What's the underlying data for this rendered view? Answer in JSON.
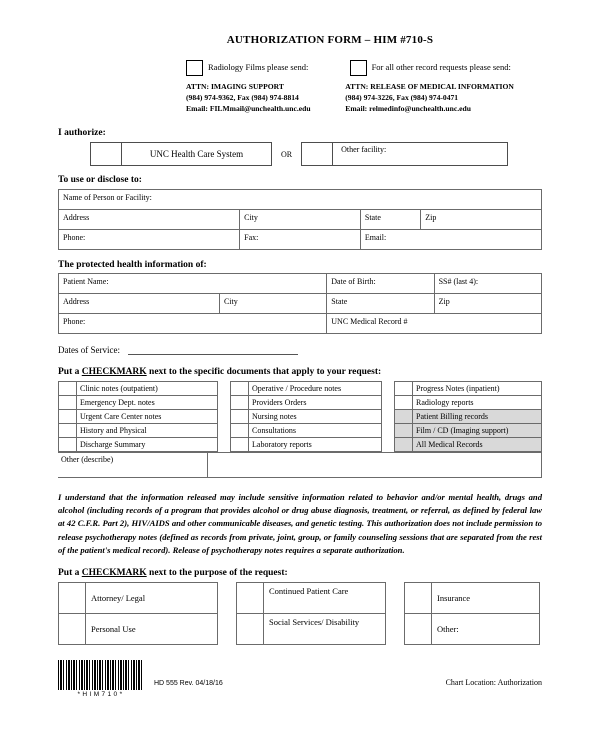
{
  "header": {
    "title": "AUTHORIZATION FORM – HIM #710-S",
    "options": [
      {
        "label": "Radiology Films please send:",
        "attn": "ATTN:  IMAGING SUPPORT",
        "phone": "(984) 974-9362, Fax (984) 974-8814",
        "email": "Email: FILMmail@unchealth.unc.edu"
      },
      {
        "label": "For all other record requests please send:",
        "attn": "ATTN:  RELEASE OF MEDICAL INFORMATION",
        "phone": "(984) 974-3226, Fax (984) 974-0471",
        "email": "Email: relmedinfo@unchealth.unc.edu"
      }
    ]
  },
  "authorize": {
    "heading": "I authorize:",
    "facility_primary": "UNC Health Care System",
    "or_label": "OR",
    "facility_other": "Other facility:"
  },
  "disclose": {
    "heading": "To use or disclose to:",
    "rows": [
      [
        "Name of Person or Facility:"
      ],
      [
        "Address",
        "City",
        "State",
        "Zip"
      ],
      [
        "Phone:",
        "Fax:",
        "Email:"
      ]
    ]
  },
  "phi": {
    "heading": "The protected health information of:",
    "rows": [
      [
        "Patient Name:",
        "Date of Birth:",
        "SS# (last 4):"
      ],
      [
        "Address",
        "City",
        "State",
        "Zip"
      ],
      [
        "Phone:",
        "UNC Medical Record #"
      ]
    ]
  },
  "dates_of_service": {
    "label": "Dates of Service:"
  },
  "documents": {
    "instruction_pre": "Put a ",
    "instruction_underline": "CHECKMARK",
    "instruction_post": " next to the specific documents that apply to your request:",
    "columns": [
      {
        "items": [
          {
            "label": "Clinic notes (outpatient)",
            "shaded": false
          },
          {
            "label": "Emergency Dept. notes",
            "shaded": false
          },
          {
            "label": "Urgent Care Center notes",
            "shaded": false
          },
          {
            "label": "History and Physical",
            "shaded": false
          },
          {
            "label": "Discharge Summary",
            "shaded": false
          }
        ]
      },
      {
        "items": [
          {
            "label": "Operative / Procedure notes",
            "shaded": false
          },
          {
            "label": "Providers Orders",
            "shaded": false
          },
          {
            "label": "Nursing notes",
            "shaded": false
          },
          {
            "label": "Consultations",
            "shaded": false
          },
          {
            "label": "Laboratory reports",
            "shaded": false
          }
        ]
      },
      {
        "items": [
          {
            "label": "Progress Notes (inpatient)",
            "shaded": false
          },
          {
            "label": "Radiology reports",
            "shaded": false
          },
          {
            "label": "Patient Billing records",
            "shaded": true
          },
          {
            "label": "Film / CD (Imaging support)",
            "shaded": true
          },
          {
            "label": "All Medical Records",
            "shaded": true
          }
        ]
      }
    ],
    "other_label": "Other (describe)"
  },
  "legal": {
    "text": "I understand that the information released may include sensitive information related to behavior and/or mental health, drugs and alcohol (including records of a program that provides alcohol or drug abuse diagnosis, treatment, or referral, as defined by federal law at 42 C.F.R. Part 2), HIV/AIDS and other communicable diseases, and genetic testing.  This authorization does not include permission to release psychotherapy notes (defined as records from private, joint, group, or family counseling sessions that are separated from the rest of the patient's medical record).  Release of psychotherapy notes requires a separate authorization."
  },
  "purpose": {
    "instruction_pre": "Put a ",
    "instruction_underline": "CHECKMARK",
    "instruction_post": " next to the purpose of the request:",
    "columns": [
      {
        "items": [
          "Attorney/ Legal",
          "Personal Use"
        ]
      },
      {
        "items": [
          "Continued Patient Care",
          "Social Services/ Disability"
        ]
      },
      {
        "items": [
          "Insurance",
          "Other:"
        ]
      }
    ]
  },
  "footer": {
    "barcode_value": "*HIM710*",
    "revision": "HD 555  Rev. 04/18/16",
    "chart_location": "Chart Location: Authorization"
  }
}
